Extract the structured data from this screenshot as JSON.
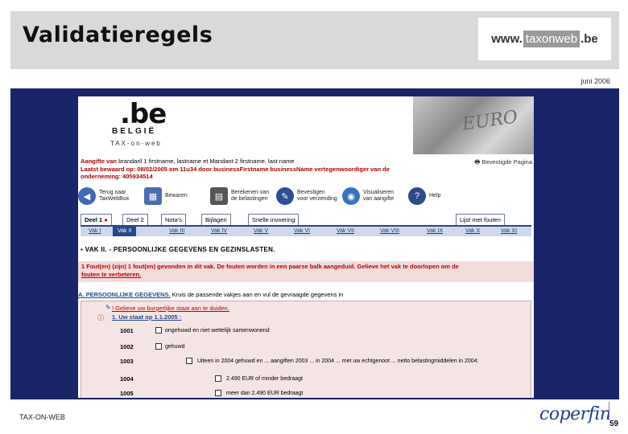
{
  "slide": {
    "title": "Validatieregels",
    "logo": {
      "www": "www.",
      "mid": "taxonweb",
      "be": ".be"
    },
    "date": "juni 2006",
    "footer_left": "TAX-ON-WEB",
    "footer_logo": "coperfin",
    "page_number": "59"
  },
  "banner": {
    "be": ".be",
    "country": "BELGIË",
    "app": "TAX-on-web",
    "coin_text": "EURO"
  },
  "info": {
    "line1_label": "Aangifte van",
    "line1_value": "brandaril 1 firstname, lastname et Mandant 2 firstname, last name",
    "line2": "Laatst bewaard op: 08/02/2005 om 11u34 door businessFirstname businessName vertegenwoordiger van de",
    "line3": "onderneming: 405934514",
    "print": "Bevestigde Pagina"
  },
  "toolbar": [
    {
      "icon": "back-icon",
      "label": "Terug naar TaxWebBox"
    },
    {
      "icon": "calculator-icon",
      "label": "Bewaren"
    },
    {
      "icon": "compute-icon",
      "label": "Berekenen van de belastingen"
    },
    {
      "icon": "pen-icon",
      "label": "Bevestigen voor verzending"
    },
    {
      "icon": "eye-icon",
      "label": "Visualiseren van aangifte"
    },
    {
      "icon": "help-icon",
      "label": "Help"
    }
  ],
  "tabs": [
    "Deel 1",
    "Deel 2",
    "Nota's",
    "Bijlagen",
    "Snelle invoering",
    "Lijst met fouten"
  ],
  "subtabs": [
    "Vak I",
    "Vak II",
    "Vak III",
    "Vak IV",
    "Vak V",
    "Vak VI",
    "Vak VII",
    "Vak VIII",
    "Vak IX",
    "Vak X",
    "Vak XI"
  ],
  "section_title": "VAK II. - PERSOONLIJKE GEGEVENS EN GEZINSLASTEN.",
  "error": {
    "line1": "1 Fout(en) (zijn) 1 fout(en) gevonden in dit vak. De fouten worden in een paarse balk aangeduid. Gelieve het vak te doorlopen om de",
    "line2": "fouten te verbeteren."
  },
  "section_a": {
    "title": "A. PERSOONLIJKE GEGEVENS.",
    "desc": "Kruis de passende vakjes aan en vul de gevraagde gegevens in"
  },
  "form": {
    "warning": "! Gelieve uw burgerlijke staat aan te duiden.",
    "question": "1. Uw staat op 1.1.2005 :",
    "rows": [
      {
        "code": "1001",
        "text": "ongehuwd en niet wettelijk samenwonend"
      },
      {
        "code": "1002",
        "text": "gehuwd"
      },
      {
        "code": "1003",
        "text": "Uiteen in 2004 gehuwd en ... aangiften 2003 ... in 2004 ... met uw echtgenoot ... netto belastingmiddelen in 2004:"
      },
      {
        "code": "1004",
        "text": "2.490 EUR of minder bedraagt"
      },
      {
        "code": "1005",
        "text": "meer dan 2.490 EUR bedraagt"
      }
    ]
  }
}
